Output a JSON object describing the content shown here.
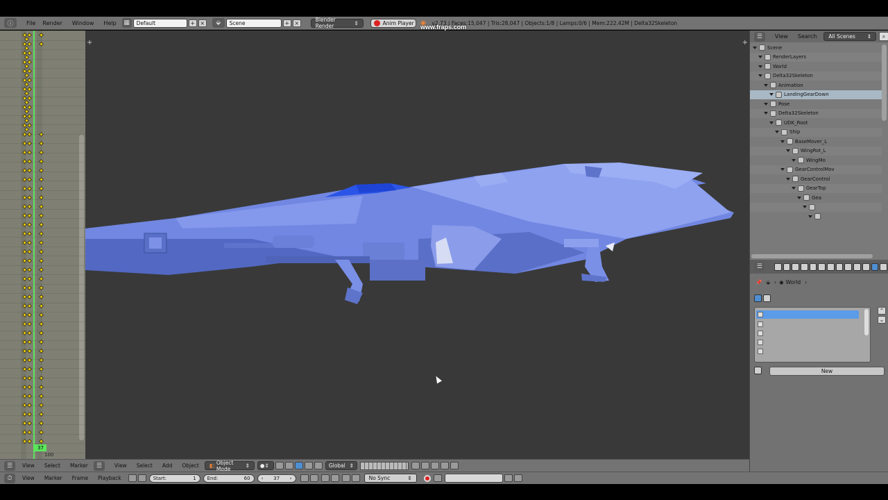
{
  "topbar": {
    "menu": [
      "File",
      "Render",
      "Window",
      "Help"
    ],
    "layout": "Default",
    "scene": "Scene",
    "engine": "Blender Render",
    "anim_player": "Anim Player",
    "stats": "v2.73  | Faces:15,047 | Tris:28,047 | Objects:1/8 | Lamps:0/6 | Mem:222.42M | Delta32Skeleton",
    "watermark": "www.fraps.com"
  },
  "dopesheet": {
    "current_frame": "37",
    "end_marker": "100",
    "footer_menu": [
      "View",
      "Select",
      "Marker"
    ]
  },
  "outliner": {
    "header": {
      "view": "View",
      "search": "Search",
      "filter": "All Scenes"
    },
    "rows": [
      {
        "label": "Scene",
        "indent": 0
      },
      {
        "label": "RenderLayers",
        "indent": 1
      },
      {
        "label": "World",
        "indent": 1
      },
      {
        "label": "Delta32Skeleton",
        "indent": 1
      },
      {
        "label": "Animation",
        "indent": 2
      },
      {
        "label": "LandingGearDown",
        "indent": 3
      },
      {
        "label": "Pose",
        "indent": 2
      },
      {
        "label": "Delta32Skeleton",
        "indent": 2
      },
      {
        "label": "UDK_Root",
        "indent": 3
      },
      {
        "label": "Ship",
        "indent": 4
      },
      {
        "label": "BaseMover_L",
        "indent": 5
      },
      {
        "label": "WingRot_L",
        "indent": 6
      },
      {
        "label": "WingMo",
        "indent": 7
      },
      {
        "label": "GearControlMov",
        "indent": 5
      },
      {
        "label": "GearControl",
        "indent": 6
      },
      {
        "label": "GearTop",
        "indent": 7
      },
      {
        "label": "Gea",
        "indent": 8
      },
      {
        "label": "",
        "indent": 9
      },
      {
        "label": "",
        "indent": 10
      }
    ]
  },
  "properties": {
    "breadcrumb": "World",
    "new_button": "New"
  },
  "view3d_bar": {
    "menu": [
      "View",
      "Select",
      "Add",
      "Object"
    ],
    "mode": "Object Mode",
    "orientation": "Global"
  },
  "timeline_bar": {
    "menu": [
      "View",
      "Marker",
      "Frame",
      "Playback"
    ],
    "start_label": "Start:",
    "start_value": "1",
    "end_label": "End:",
    "end_value": "60",
    "current": "37",
    "sync": "No Sync"
  },
  "colors": {
    "ship": "#6e86e0",
    "ship_dark": "#4d63b8",
    "canopy": "#2a55e8",
    "viewport_bg": "#393939",
    "playhead": "#5be65b",
    "keyframe": "#f0d000"
  }
}
